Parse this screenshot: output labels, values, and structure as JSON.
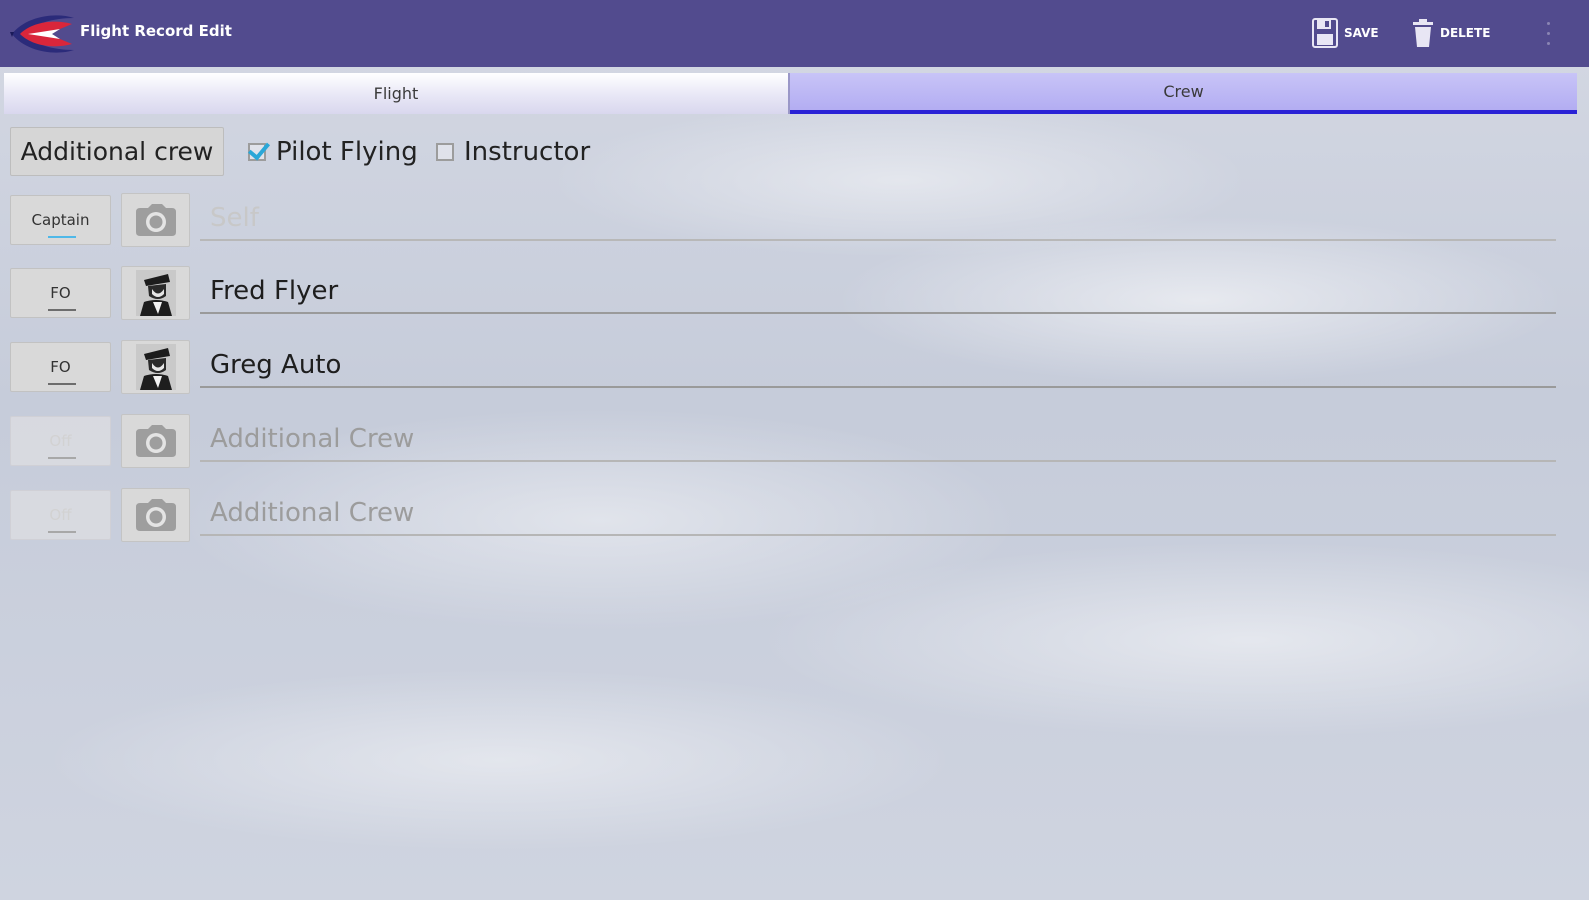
{
  "actionbar": {
    "title": "Flight Record Edit",
    "save_label": "SAVE",
    "delete_label": "DELETE",
    "background_color": "#524b8e"
  },
  "tabs": [
    {
      "label": "Flight",
      "selected": false
    },
    {
      "label": "Crew",
      "selected": true
    }
  ],
  "controls": {
    "additional_crew_button": "Additional crew",
    "pilot_flying_label": "Pilot Flying",
    "pilot_flying_checked": true,
    "instructor_label": "Instructor",
    "instructor_checked": false
  },
  "crew": [
    {
      "role": "Captain",
      "photo": "camera-icon",
      "name": "",
      "placeholder": "Self"
    },
    {
      "role": "FO",
      "photo": "pilot-portrait",
      "name": "Fred Flyer",
      "placeholder": ""
    },
    {
      "role": "FO",
      "photo": "pilot-portrait",
      "name": "Greg Auto",
      "placeholder": ""
    },
    {
      "role": "Off",
      "photo": "camera-icon",
      "name": "",
      "placeholder": "Additional Crew"
    },
    {
      "role": "Off",
      "photo": "camera-icon",
      "name": "",
      "placeholder": "Additional Crew"
    }
  ],
  "colors": {
    "tab_indicator": "#2a22d6",
    "checkbox_check": "#2aa7d8",
    "active_toggle_underline": "#4fb8e8"
  }
}
